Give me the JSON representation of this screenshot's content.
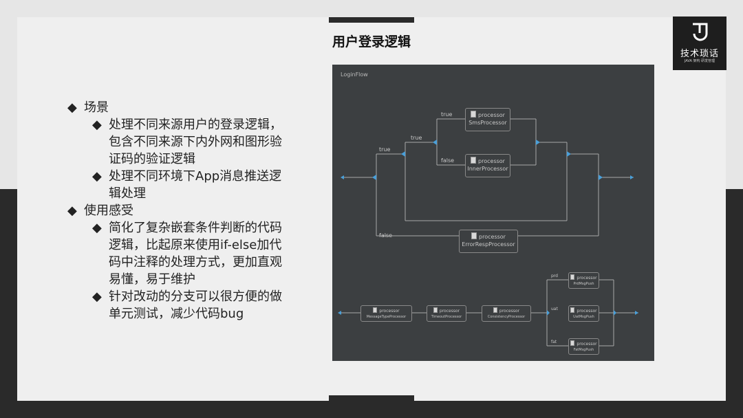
{
  "slide": {
    "title": "用户登录逻辑",
    "logo": {
      "name": "技术琐话",
      "sub": "JAVA 架构 研发管理"
    }
  },
  "bullets": [
    {
      "label": "场景",
      "children": [
        [
          "处理不同来源用户的登录逻辑，",
          "包含不同来源下内外网和图形验",
          "证码的验证逻辑"
        ],
        [
          "处理不同环境下App消息推送逻",
          "辑处理"
        ]
      ]
    },
    {
      "label": "使用感受",
      "children": [
        [
          "简化了复杂嵌套条件判断的代码",
          "逻辑，比起原来使用if-else加代",
          "码中注释的处理方式，更加直观",
          "易懂，易于维护"
        ],
        [
          "针对改动的分支可以很方便的做",
          "单元测试，减少代码bug"
        ]
      ]
    }
  ],
  "diagram": {
    "flow_title": "LoginFlow",
    "processor_tag": "processor",
    "nodes": {
      "sms": "SmsProcessor",
      "inner": "InnerProcessor",
      "error": "ErrorRespProcessor",
      "msgtype": "MessageTypeProcessor",
      "timeout": "TimeoutProcessor",
      "consistency": "ConsistencyProcessor",
      "prd": "PrdMsgPush",
      "uat": "UatMsgPush",
      "fat": "FatMsgPush"
    },
    "labels": {
      "true_inner": "true",
      "true_mid": "true",
      "true_outer": "true",
      "false_inner": "false",
      "false_outer": "false",
      "prd": "prd",
      "uat": "uat",
      "fat": "fat"
    },
    "colors": {
      "background": "#3c3f41",
      "line": "#a9a9a9",
      "arrow": "#4a9fd8",
      "node_border": "#8a8a8a"
    }
  }
}
